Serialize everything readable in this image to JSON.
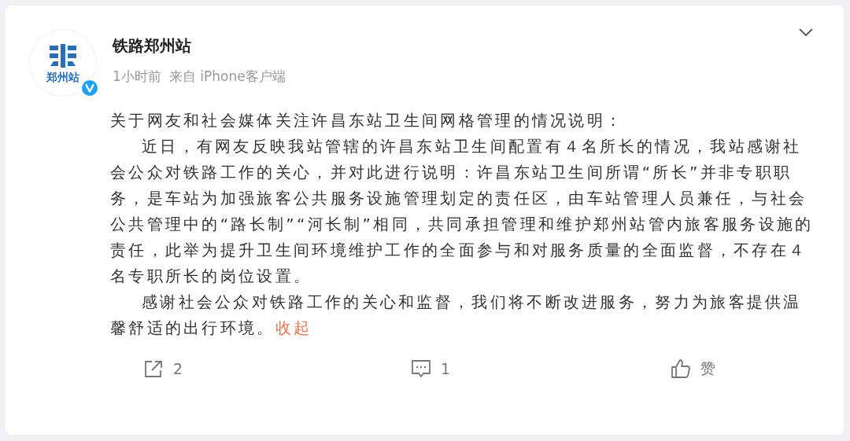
{
  "post": {
    "author": {
      "name": "铁路郑州站",
      "avatar_logo": "郑州站",
      "verified": true
    },
    "time": "1小时前",
    "source": "来自 iPhone客户端",
    "body": {
      "title": "关于网友和社会媒体关注许昌东站卫生间网格管理的情况说明：",
      "paragraphs": [
        "近日，有网友反映我站管辖的许昌东站卫生间配置有４名所长的情况，我站感谢社会公众对铁路工作的关心，并对此进行说明：许昌东站卫生间所谓“所长”并非专职职务，是车站为加强旅客公共服务设施管理划定的责任区，由车站管理人员兼任，与社会公共管理中的“路长制”“河长制”相同，共同承担管理和维护郑州站管内旅客服务设施的责任，此举为提升卫生间环境维护工作的全面参与和对服务质量的全面监督，不存在４名专职所长的岗位设置。",
        "感谢社会公众对铁路工作的关心和监督，我们将不断改进服务，努力为旅客提供温馨舒适的出行环境。"
      ],
      "collapse_link": "收起"
    },
    "actions": [
      {
        "kind": "share",
        "label": "2"
      },
      {
        "kind": "comment",
        "label": "1"
      },
      {
        "kind": "like",
        "label": "赞"
      }
    ]
  }
}
